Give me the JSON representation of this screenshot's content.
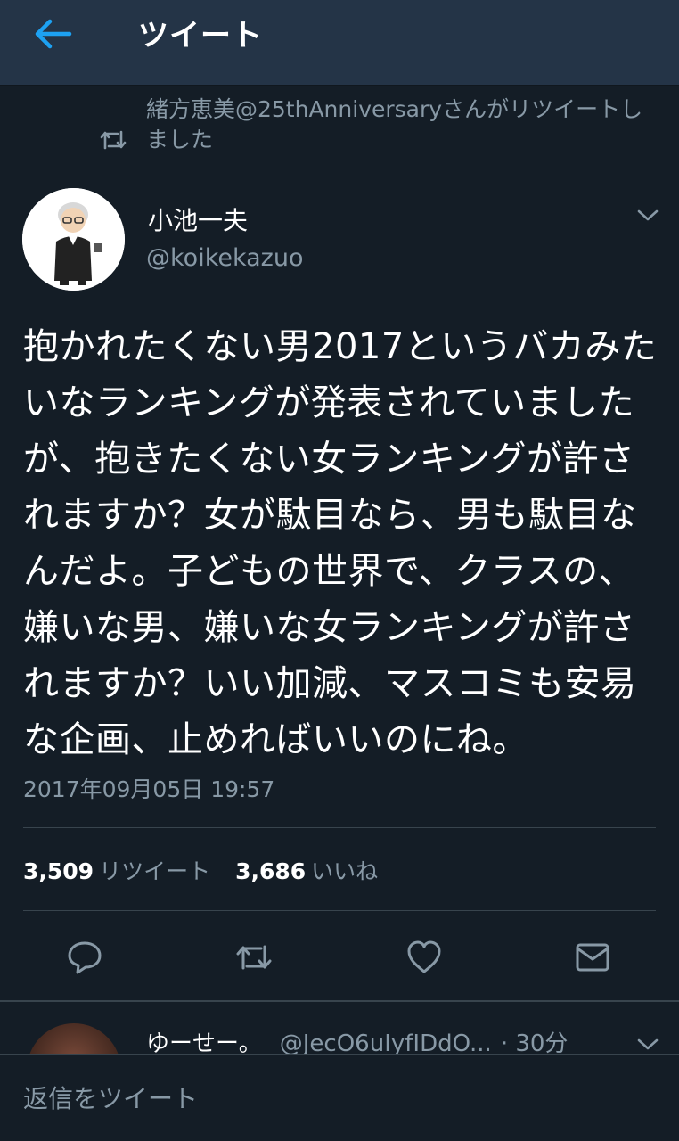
{
  "header": {
    "title": "ツイート"
  },
  "retweet_context": {
    "text": "緒方恵美@25thAnniversaryさんがリツイートしました"
  },
  "tweet": {
    "author_name": "小池一夫",
    "author_handle": "@koikekazuo",
    "text": "抱かれたくない男2017というバカみたいなランキングが発表されていましたが、抱きたくない女ランキングが許されますか？女が駄目なら、男も駄目なんだよ。子どもの世界で、クラスの、嫌いな男、嫌いな女ランキングが許されますか？いい加減、マスコミも安易な企画、止めればいいのにね。",
    "timestamp": "2017年09月05日 19:57",
    "retweets_count": "3,509",
    "retweets_label": "リツイート",
    "likes_count": "3,686",
    "likes_label": "いいね"
  },
  "reply_preview": {
    "name": "ゆーせー。",
    "handle": "@JecO6uIyfIDdO...",
    "time": "· 30分"
  },
  "reply_box": {
    "placeholder": "返信をツイート"
  },
  "icons": {
    "back": "arrow-left-icon",
    "retweet_small": "retweet-icon",
    "caret": "chevron-down-icon",
    "reply": "reply-icon",
    "retweet": "retweet-icon",
    "like": "heart-icon",
    "dm": "envelope-icon"
  },
  "colors": {
    "accent": "#1da1f2",
    "background": "#141d26",
    "header": "#243447",
    "secondary_text": "#8899a6"
  }
}
